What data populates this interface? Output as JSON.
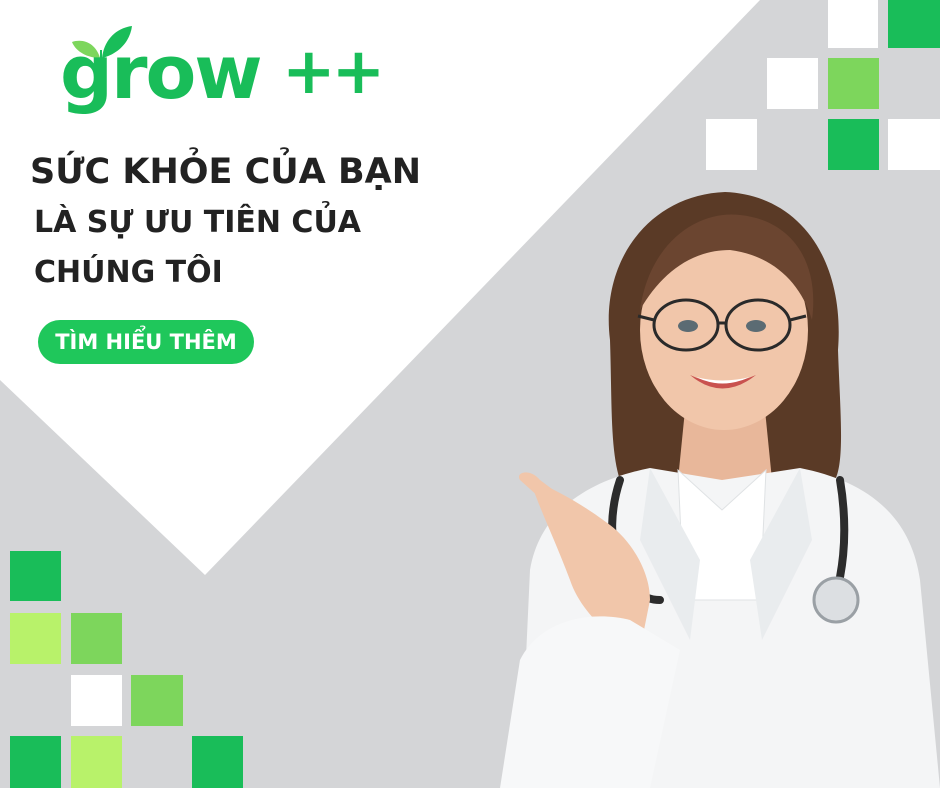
{
  "brand": {
    "name": "grow",
    "suffix": "++"
  },
  "headline": {
    "line1": "SỨC KHỎE CỦA BẠN",
    "line2": "LÀ SỰ ƯU TIÊN CỦA",
    "line3": "CHÚNG TÔI"
  },
  "cta": {
    "label": "TÌM HIỂU THÊM"
  },
  "colors": {
    "brand_green": "#19bd59",
    "light_green": "#7dd65c",
    "lime_green": "#b8f26a",
    "background_gray": "#d4d5d7",
    "panel_white": "#ffffff"
  },
  "icons": {
    "logo_leaf": "leaf-icon",
    "stethoscope": "stethoscope-icon"
  }
}
